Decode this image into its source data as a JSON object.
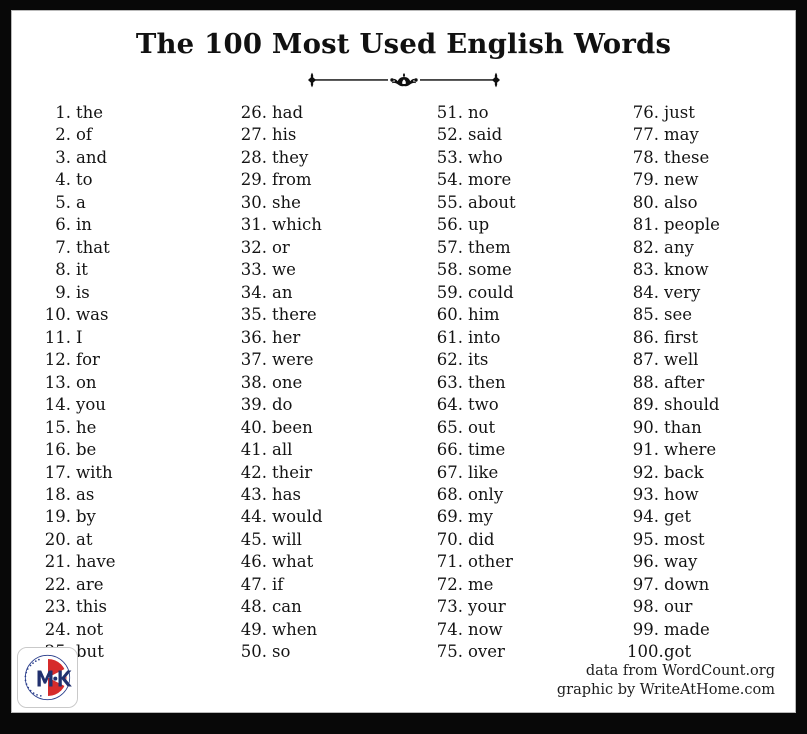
{
  "poster": {
    "title": "The 100 Most Used English Words",
    "divider_icon": "floral-ornament-divider",
    "background_color": "#ffffff",
    "frame_color": "#080808",
    "text_color": "#141414"
  },
  "columns": [
    {
      "name": "column-1",
      "range": "1-25",
      "entries": [
        {
          "rank": "1.",
          "word": "the"
        },
        {
          "rank": "2.",
          "word": "of"
        },
        {
          "rank": "3.",
          "word": "and"
        },
        {
          "rank": "4.",
          "word": "to"
        },
        {
          "rank": "5.",
          "word": "a"
        },
        {
          "rank": "6.",
          "word": "in"
        },
        {
          "rank": "7.",
          "word": "that"
        },
        {
          "rank": "8.",
          "word": "it"
        },
        {
          "rank": "9.",
          "word": "is"
        },
        {
          "rank": "10.",
          "word": "was"
        },
        {
          "rank": "11.",
          "word": "I"
        },
        {
          "rank": "12.",
          "word": "for"
        },
        {
          "rank": "13.",
          "word": "on"
        },
        {
          "rank": "14.",
          "word": "you"
        },
        {
          "rank": "15.",
          "word": "he"
        },
        {
          "rank": "16.",
          "word": "be"
        },
        {
          "rank": "17.",
          "word": "with"
        },
        {
          "rank": "18.",
          "word": "as"
        },
        {
          "rank": "19.",
          "word": "by"
        },
        {
          "rank": "20.",
          "word": "at"
        },
        {
          "rank": "21.",
          "word": "have"
        },
        {
          "rank": "22.",
          "word": "are"
        },
        {
          "rank": "23.",
          "word": "this"
        },
        {
          "rank": "24.",
          "word": "not"
        },
        {
          "rank": "25.",
          "word": "but"
        }
      ]
    },
    {
      "name": "column-2",
      "range": "26-50",
      "entries": [
        {
          "rank": "26.",
          "word": "had"
        },
        {
          "rank": "27.",
          "word": "his"
        },
        {
          "rank": "28.",
          "word": "they"
        },
        {
          "rank": "29.",
          "word": "from"
        },
        {
          "rank": "30.",
          "word": "she"
        },
        {
          "rank": "31.",
          "word": "which"
        },
        {
          "rank": "32.",
          "word": "or"
        },
        {
          "rank": "33.",
          "word": "we"
        },
        {
          "rank": "34.",
          "word": "an"
        },
        {
          "rank": "35.",
          "word": "there"
        },
        {
          "rank": "36.",
          "word": "her"
        },
        {
          "rank": "37.",
          "word": "were"
        },
        {
          "rank": "38.",
          "word": "one"
        },
        {
          "rank": "39.",
          "word": "do"
        },
        {
          "rank": "40.",
          "word": "been"
        },
        {
          "rank": "41.",
          "word": "all"
        },
        {
          "rank": "42.",
          "word": "their"
        },
        {
          "rank": "43.",
          "word": "has"
        },
        {
          "rank": "44.",
          "word": "would"
        },
        {
          "rank": "45.",
          "word": "will"
        },
        {
          "rank": "46.",
          "word": "what"
        },
        {
          "rank": "47.",
          "word": "if"
        },
        {
          "rank": "48.",
          "word": "can"
        },
        {
          "rank": "49.",
          "word": "when"
        },
        {
          "rank": "50.",
          "word": "so"
        }
      ]
    },
    {
      "name": "column-3",
      "range": "51-75",
      "entries": [
        {
          "rank": "51.",
          "word": "no"
        },
        {
          "rank": "52.",
          "word": "said"
        },
        {
          "rank": "53.",
          "word": "who"
        },
        {
          "rank": "54.",
          "word": "more"
        },
        {
          "rank": "55.",
          "word": "about"
        },
        {
          "rank": "56.",
          "word": "up"
        },
        {
          "rank": "57.",
          "word": "them"
        },
        {
          "rank": "58.",
          "word": "some"
        },
        {
          "rank": "59.",
          "word": "could"
        },
        {
          "rank": "60.",
          "word": "him"
        },
        {
          "rank": "61.",
          "word": "into"
        },
        {
          "rank": "62.",
          "word": "its"
        },
        {
          "rank": "63.",
          "word": "then"
        },
        {
          "rank": "64.",
          "word": "two"
        },
        {
          "rank": "65.",
          "word": "out"
        },
        {
          "rank": "66.",
          "word": "time"
        },
        {
          "rank": "67.",
          "word": "like"
        },
        {
          "rank": "68.",
          "word": "only"
        },
        {
          "rank": "69.",
          "word": "my"
        },
        {
          "rank": "70.",
          "word": "did"
        },
        {
          "rank": "71.",
          "word": "other"
        },
        {
          "rank": "72.",
          "word": "me"
        },
        {
          "rank": "73.",
          "word": "your"
        },
        {
          "rank": "74.",
          "word": "now"
        },
        {
          "rank": "75.",
          "word": "over"
        }
      ]
    },
    {
      "name": "column-4",
      "range": "76-100",
      "entries": [
        {
          "rank": "76.",
          "word": "just"
        },
        {
          "rank": "77.",
          "word": "may"
        },
        {
          "rank": "78.",
          "word": "these"
        },
        {
          "rank": "79.",
          "word": "new"
        },
        {
          "rank": "80.",
          "word": "also"
        },
        {
          "rank": "81.",
          "word": "people"
        },
        {
          "rank": "82.",
          "word": "any"
        },
        {
          "rank": "83.",
          "word": "know"
        },
        {
          "rank": "84.",
          "word": "very"
        },
        {
          "rank": "85.",
          "word": "see"
        },
        {
          "rank": "86.",
          "word": "first"
        },
        {
          "rank": "87.",
          "word": "well"
        },
        {
          "rank": "88.",
          "word": "after"
        },
        {
          "rank": "89.",
          "word": "should"
        },
        {
          "rank": "90.",
          "word": "than"
        },
        {
          "rank": "91.",
          "word": "where"
        },
        {
          "rank": "92.",
          "word": "back"
        },
        {
          "rank": "93.",
          "word": "how"
        },
        {
          "rank": "94.",
          "word": "get"
        },
        {
          "rank": "95.",
          "word": "most"
        },
        {
          "rank": "96.",
          "word": "way"
        },
        {
          "rank": "97.",
          "word": "down"
        },
        {
          "rank": "98.",
          "word": "our"
        },
        {
          "rank": "99.",
          "word": "made"
        },
        {
          "rank": "100.",
          "word": "got"
        }
      ]
    }
  ],
  "footer": {
    "data_credit": "data from WordCount.org",
    "graphic_credit": "graphic by WriteAtHome.com"
  },
  "logo": {
    "name": "mk-circular-logo",
    "monogram": "M K",
    "ring_text": "for the world",
    "ring_color": "#2b3f8c",
    "wedge_color": "#d62b2b"
  }
}
